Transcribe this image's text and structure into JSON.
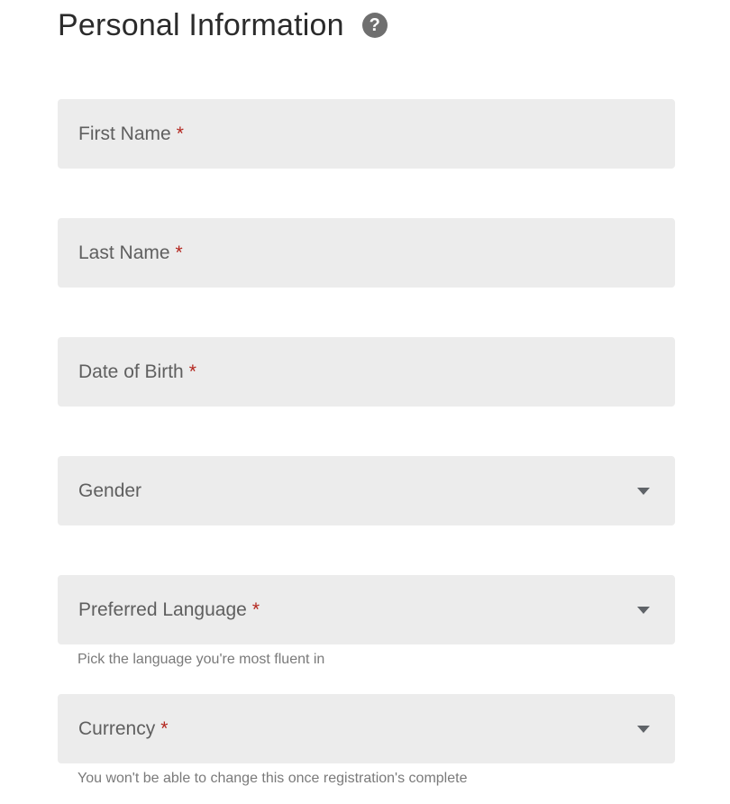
{
  "section": {
    "title": "Personal Information",
    "help_icon": "question-circle-icon"
  },
  "fields": {
    "first_name": {
      "label": "First Name",
      "required_mark": "*"
    },
    "last_name": {
      "label": "Last Name",
      "required_mark": "*"
    },
    "date_of_birth": {
      "label": "Date of Birth",
      "required_mark": "*"
    },
    "gender": {
      "label": "Gender"
    },
    "preferred_language": {
      "label": "Preferred Language",
      "required_mark": "*",
      "hint": "Pick the language you're most fluent in"
    },
    "currency": {
      "label": "Currency",
      "required_mark": "*",
      "hint": "You won't be able to change this once registration's complete"
    }
  },
  "colors": {
    "field_background": "#ececec",
    "required": "#b3261e",
    "label": "#5f5f5f",
    "title": "#2b2b2b"
  }
}
